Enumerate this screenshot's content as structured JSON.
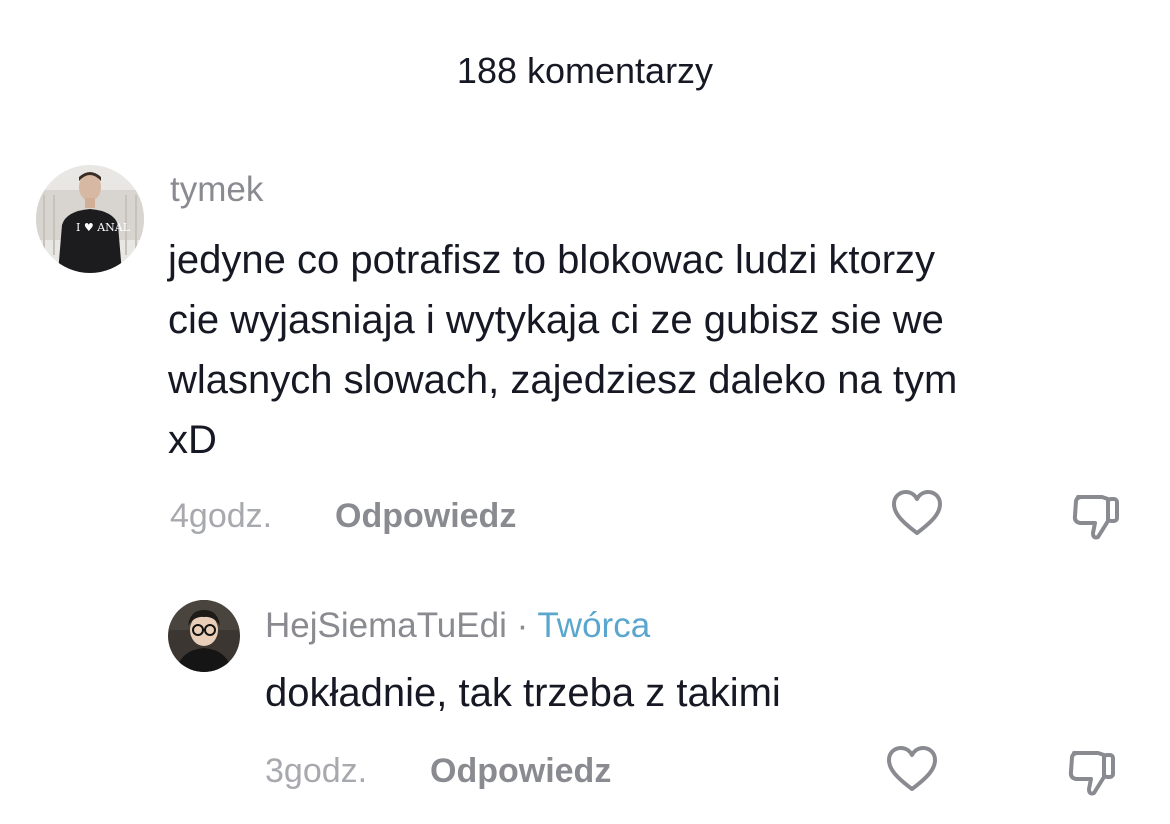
{
  "header": {
    "title": "188 komentarzy"
  },
  "comments": [
    {
      "username": "tymek",
      "text_lines": [
        "jedyne co potrafisz to blokowac ludzi ktorzy",
        "cie wyjasniaja i wytykaja ci ze gubisz sie we",
        "wlasnych slowach, zajedziesz daleko na tym",
        "xD"
      ],
      "time": "4godz.",
      "reply_label": "Odpowiedz",
      "avatar_shirt_text": "I ♥ ANAL",
      "icons": {
        "like": "heart-outline-icon",
        "dislike": "thumbs-down-icon"
      }
    },
    {
      "username": "HejSiemaTuEdi",
      "separator": " · ",
      "badge": "Twórca",
      "text_lines": [
        "dokładnie, tak trzeba z takimi"
      ],
      "time": "3godz.",
      "reply_label": "Odpowiedz",
      "icons": {
        "like": "heart-outline-icon",
        "dislike": "thumbs-down-icon"
      }
    }
  ],
  "colors": {
    "text_primary": "#161823",
    "text_secondary": "#8a8b91",
    "text_muted": "#a8a9ae",
    "creator_badge": "#5aa6cf",
    "background": "#ffffff"
  }
}
